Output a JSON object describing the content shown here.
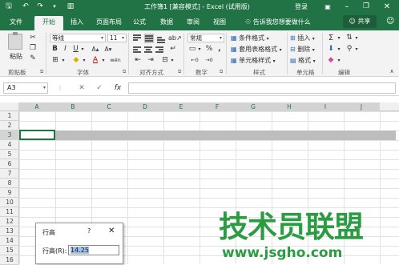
{
  "title_bar": {
    "title": "工作簿1 [兼容模式] - Excel (试用版)",
    "login": "登录",
    "quick_access": [
      "save-icon",
      "undo-icon",
      "redo-icon",
      "customize-icon"
    ],
    "window_controls": [
      "ribbon-display-icon",
      "minimize-icon",
      "restore-icon",
      "close-icon"
    ]
  },
  "tabs": [
    "文件",
    "开始",
    "插入",
    "页面布局",
    "公式",
    "数据",
    "审阅",
    "视图"
  ],
  "active_tab": "开始",
  "tell_me": "告诉我您想要做什么",
  "share": "共享",
  "ribbon": {
    "clipboard": {
      "label": "剪贴板",
      "paste": "粘贴"
    },
    "font": {
      "label": "字体",
      "font_name": "等线",
      "font_size": "11",
      "bold": "B",
      "italic": "I",
      "underline": "U",
      "font_color_letter": "A",
      "phonetic": "wén"
    },
    "alignment": {
      "label": "对齐方式"
    },
    "number": {
      "label": "数字",
      "format": "常规",
      "percent": "%",
      "comma": ","
    },
    "styles": {
      "label": "样式",
      "conditional": "条件格式",
      "table": "套用表格格式",
      "cell_styles": "单元格样式"
    },
    "cells": {
      "label": "单元格",
      "insert": "插入",
      "delete": "删除",
      "format": "格式"
    },
    "editing": {
      "label": "编辑",
      "sum": "Σ"
    }
  },
  "formula_bar": {
    "name_box": "A3",
    "cancel": "✕",
    "enter": "✓",
    "fx": "fx",
    "value": ""
  },
  "columns": [
    "A",
    "B",
    "C",
    "D",
    "E",
    "F",
    "G",
    "H",
    "I",
    "J"
  ],
  "rows": [
    "1",
    "2",
    "3",
    "4",
    "5",
    "6",
    "7",
    "8",
    "9",
    "10",
    "11",
    "12",
    "13",
    "14",
    "15",
    "16"
  ],
  "selected_row": "3",
  "dialog": {
    "title": "行高",
    "help": "?",
    "close": "✕",
    "label": "行高(R):",
    "value": "14.25"
  },
  "watermark": {
    "text": "技术员联盟",
    "url": "www.jsgho.com"
  },
  "colors": {
    "excel_green": "#217346",
    "watermark_green": "#2c9c43"
  }
}
